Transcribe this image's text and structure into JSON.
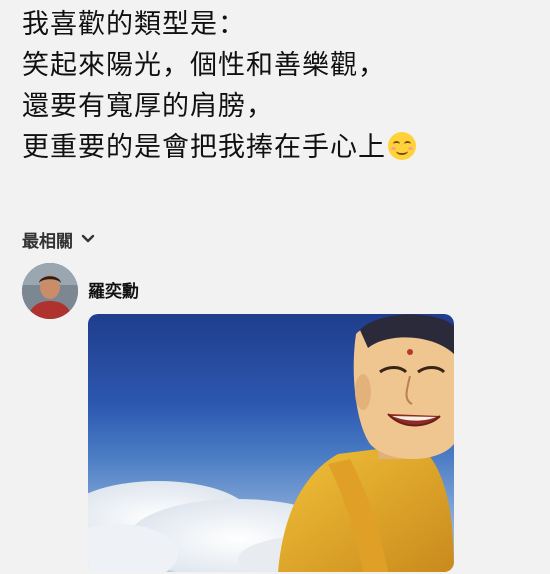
{
  "post": {
    "lines": [
      "我喜歡的類型是：",
      "笑起來陽光，個性和善樂觀，",
      "還要有寬厚的肩膀，",
      "更重要的是會把我捧在手心上"
    ],
    "trailing_icon": "smiling-face-emoji"
  },
  "comments_filter": {
    "label": "最相關",
    "icon": "chevron-down-icon"
  },
  "comment": {
    "author": "羅奕勳",
    "avatar_icon": "avatar"
  },
  "colors": {
    "background": "#f2f2f2",
    "text": "#111111"
  }
}
